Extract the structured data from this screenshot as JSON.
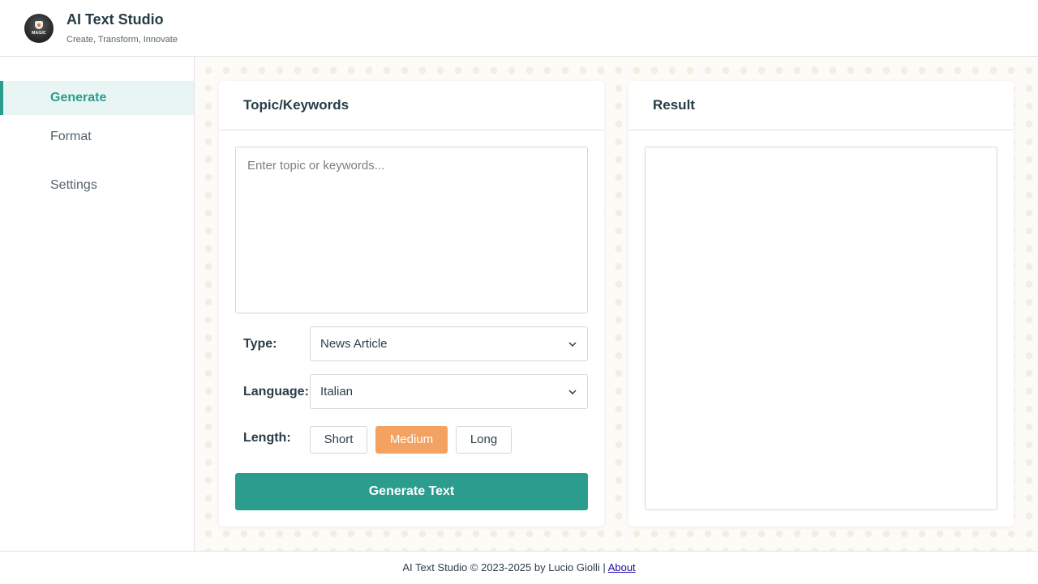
{
  "header": {
    "title": "AI Text Studio",
    "subtitle": "Create, Transform, Innovate",
    "logo_text": "MAGIC"
  },
  "sidebar": {
    "items": [
      {
        "label": "Generate",
        "active": true
      },
      {
        "label": "Format",
        "active": false
      },
      {
        "label": "Settings",
        "active": false
      }
    ]
  },
  "generate_panel": {
    "title": "Topic/Keywords",
    "topic_placeholder": "Enter topic or keywords...",
    "topic_value": "",
    "type_label": "Type:",
    "type_value": "News Article",
    "language_label": "Language:",
    "language_value": "Italian",
    "length_label": "Length:",
    "length_options": [
      "Short",
      "Medium",
      "Long"
    ],
    "length_selected": "Medium",
    "generate_label": "Generate Text"
  },
  "result_panel": {
    "title": "Result",
    "content": ""
  },
  "footer": {
    "text": "AI Text Studio © 2023-2025 by Lucio Giolli | ",
    "about_label": "About"
  },
  "colors": {
    "accent": "#2a9d8f",
    "active_length": "#f4a261",
    "text_dark": "#263d47"
  },
  "icons": {
    "logo": "wizard-hat-logo",
    "select_chevron": "chevron-down-icon"
  }
}
